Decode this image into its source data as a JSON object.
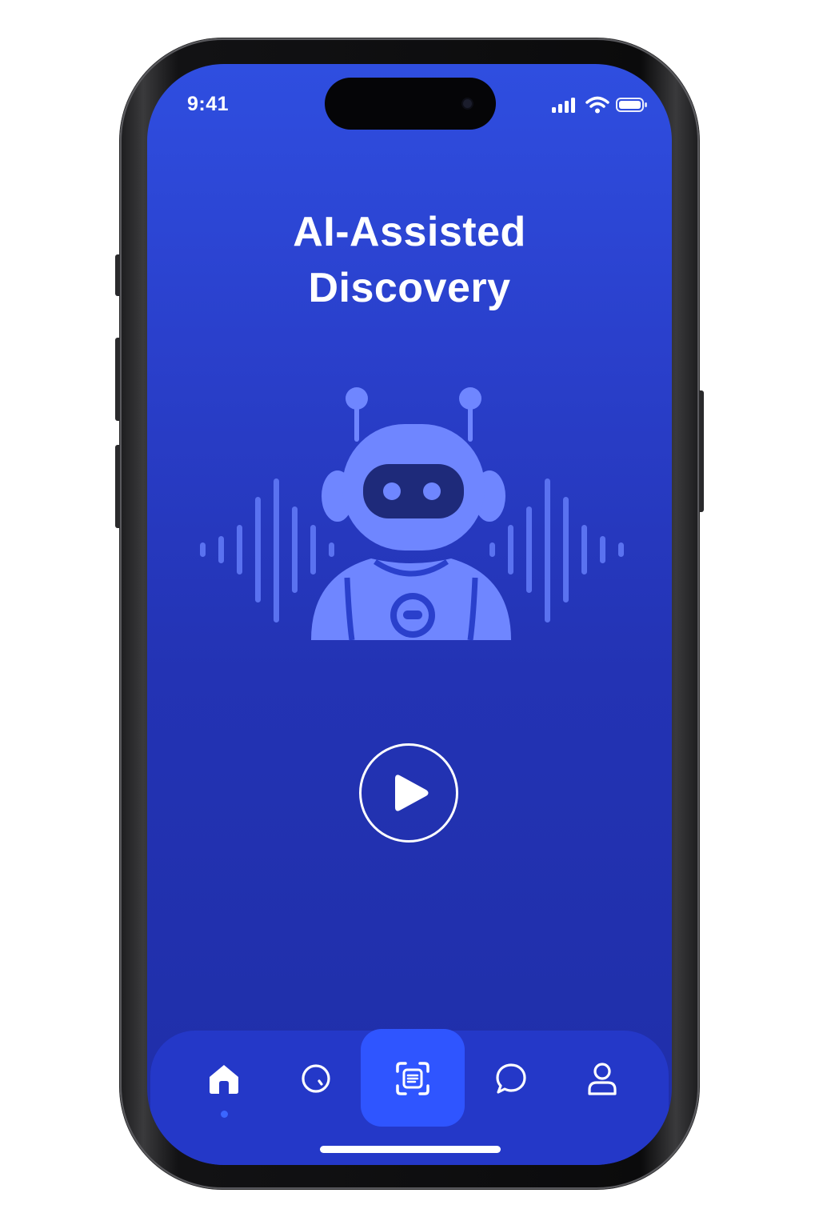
{
  "status_bar": {
    "time": "9:41",
    "icons": [
      "cellular-signal-icon",
      "wifi-icon",
      "battery-icon"
    ]
  },
  "main": {
    "title_line1": "AI-Assisted",
    "title_line2": "Discovery",
    "illustration": [
      "robot-icon",
      "sound-wave-icon"
    ],
    "play_button_icon": "play-icon"
  },
  "tab_bar": {
    "active_tab": "home",
    "items": [
      {
        "key": "home",
        "icon": "home-icon"
      },
      {
        "key": "explore",
        "icon": "compass-icon"
      },
      {
        "key": "scan",
        "icon": "scan-icon"
      },
      {
        "key": "messages",
        "icon": "chat-bubble-icon"
      },
      {
        "key": "profile",
        "icon": "user-icon"
      }
    ]
  },
  "colors": {
    "background_top": "#2f4ee0",
    "background_bottom": "#1f2ea8",
    "robot": "#6f86ff",
    "robot_face": "#1e2a7a",
    "wave": "#5a72f0",
    "tab_bar": "#2438c8",
    "scan_highlight": "#2f55ff",
    "active_dot": "#3b66ff",
    "text": "#ffffff"
  }
}
